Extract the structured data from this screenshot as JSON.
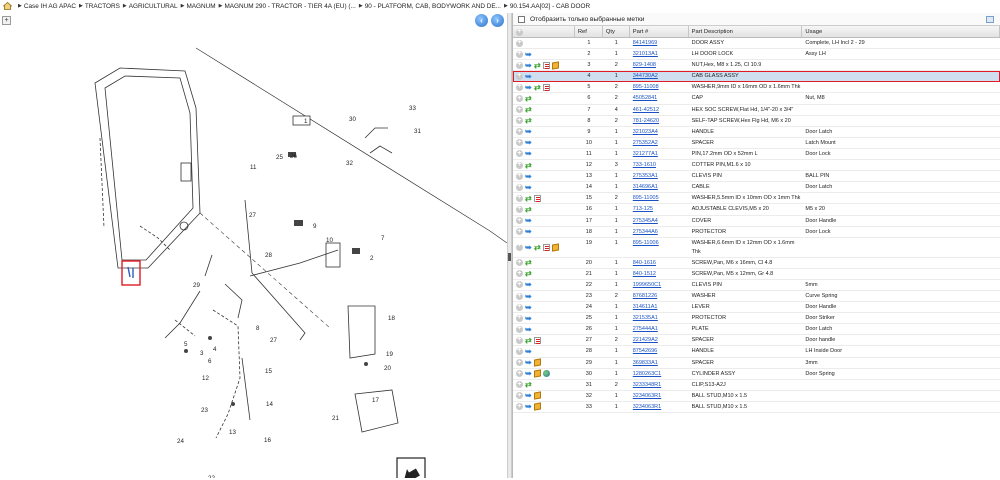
{
  "breadcrumb": [
    "Case IH AG APAC",
    "TRACTORS",
    "AGRICULTURAL",
    "MAGNUM",
    "MAGNUM 290 - TRACTOR - TIER 4A (EU) (...",
    "90 - PLATFORM, CAB, BODYWORK AND DE...",
    "90.154.AA[02] - CAB DOOR"
  ],
  "left_toolbar": {
    "expand_symbol": "+",
    "prev_symbol": "‹",
    "next_symbol": "›"
  },
  "diagram": {
    "callouts": [
      "1",
      "2",
      "3",
      "4",
      "5",
      "6",
      "7",
      "8",
      "9",
      "10",
      "11",
      "12",
      "13",
      "14",
      "15",
      "16",
      "17",
      "18",
      "19",
      "20",
      "21",
      "22",
      "23",
      "24",
      "25",
      "26",
      "27",
      "27",
      "28",
      "29",
      "30",
      "31",
      "32",
      "33"
    ]
  },
  "filter": {
    "label": "Отобразить только выбранные метки",
    "checked": false
  },
  "table": {
    "columns": [
      "Ref",
      "Qty",
      "Part #",
      "Part Description",
      "Usage"
    ],
    "rows": [
      {
        "icons": [
          "plus"
        ],
        "ref": "1",
        "qty": "1",
        "part": "84141969",
        "desc": "DOOR ASSY",
        "usage": "Complete, LH Incl 2 - 29"
      },
      {
        "icons": [
          "plus",
          "info"
        ],
        "ref": "2",
        "qty": "1",
        "part": "321013A1",
        "desc": "LH DOOR LOCK",
        "usage": "Assy LH"
      },
      {
        "icons": [
          "plus",
          "info",
          "swap",
          "doc",
          "box"
        ],
        "ref": "3",
        "qty": "2",
        "part": "829-1408",
        "desc": "NUT,Hex, M8 x 1.25, Cl 10.9",
        "usage": ""
      },
      {
        "icons": [
          "plus",
          "info"
        ],
        "ref": "4",
        "qty": "1",
        "part": "344730A2",
        "desc": "CAB GLASS ASSY",
        "usage": "",
        "selected": true
      },
      {
        "icons": [
          "plus",
          "info",
          "swap",
          "doc"
        ],
        "ref": "5",
        "qty": "2",
        "part": "895-11008",
        "desc": "WASHER,9mm ID x 16mm OD x 1.6mm Thk",
        "usage": ""
      },
      {
        "icons": [
          "plus",
          "swap"
        ],
        "ref": "6",
        "qty": "2",
        "part": "45052841",
        "desc": "CAP",
        "usage": "Nut, M8"
      },
      {
        "icons": [
          "plus",
          "swap"
        ],
        "ref": "7",
        "qty": "4",
        "part": "461-42512",
        "desc": "HEX SOC SCREW,Flat Hd, 1/4\"-20 x 3/4\"",
        "usage": ""
      },
      {
        "icons": [
          "plus",
          "swap"
        ],
        "ref": "8",
        "qty": "2",
        "part": "781-24620",
        "desc": "SELF-TAP SCREW,Hex Flg Hd, M6 x 20",
        "usage": ""
      },
      {
        "icons": [
          "plus",
          "info"
        ],
        "ref": "9",
        "qty": "1",
        "part": "321023A4",
        "desc": "HANDLE",
        "usage": "Door Latch"
      },
      {
        "icons": [
          "plus",
          "info"
        ],
        "ref": "10",
        "qty": "1",
        "part": "275352A2",
        "desc": "SPACER",
        "usage": "Latch Mount"
      },
      {
        "icons": [
          "plus",
          "info"
        ],
        "ref": "11",
        "qty": "1",
        "part": "321277A1",
        "desc": "PIN,17.2mm OD x 52mm L",
        "usage": "Door Lock"
      },
      {
        "icons": [
          "plus",
          "swap"
        ],
        "ref": "12",
        "qty": "3",
        "part": "733-1610",
        "desc": "COTTER PIN,M1.6 x 10",
        "usage": ""
      },
      {
        "icons": [
          "plus",
          "info"
        ],
        "ref": "13",
        "qty": "1",
        "part": "275353A1",
        "desc": "CLEVIS PIN",
        "usage": "BALL PIN"
      },
      {
        "icons": [
          "plus",
          "info"
        ],
        "ref": "14",
        "qty": "1",
        "part": "314696A1",
        "desc": "CABLE",
        "usage": "Door Latch"
      },
      {
        "icons": [
          "plus",
          "swap",
          "doc"
        ],
        "ref": "15",
        "qty": "2",
        "part": "895-11005",
        "desc": "WASHER,5.5mm ID x 10mm OD x 1mm Thk",
        "usage": ""
      },
      {
        "icons": [
          "plus",
          "swap"
        ],
        "ref": "16",
        "qty": "1",
        "part": "713-125",
        "desc": "ADJUSTABLE CLEVIS,M5 x 20",
        "usage": "M5 x 20"
      },
      {
        "icons": [
          "plus",
          "info"
        ],
        "ref": "17",
        "qty": "1",
        "part": "275345A4",
        "desc": "COVER",
        "usage": "Door Handle"
      },
      {
        "icons": [
          "plus",
          "info"
        ],
        "ref": "18",
        "qty": "1",
        "part": "275344A6",
        "desc": "PROTECTOR",
        "usage": "Door Lock"
      },
      {
        "icons": [
          "plus",
          "info",
          "swap",
          "doc",
          "box"
        ],
        "ref": "19",
        "qty": "1",
        "part": "895-11006",
        "desc": "WASHER,6.6mm ID x 12mm OD x 1.6mm Thk",
        "usage": "",
        "tall": true
      },
      {
        "icons": [
          "plus",
          "swap"
        ],
        "ref": "20",
        "qty": "1",
        "part": "840-1616",
        "desc": "SCREW,Pan, M6 x 16mm, Cl 4.8",
        "usage": ""
      },
      {
        "icons": [
          "plus",
          "swap"
        ],
        "ref": "21",
        "qty": "1",
        "part": "840-1512",
        "desc": "SCREW,Pan, M5 x 12mm, Gr 4.8",
        "usage": ""
      },
      {
        "icons": [
          "plus",
          "info"
        ],
        "ref": "22",
        "qty": "1",
        "part": "1999650C1",
        "desc": "CLEVIS PIN",
        "usage": "5mm"
      },
      {
        "icons": [
          "plus",
          "info"
        ],
        "ref": "23",
        "qty": "2",
        "part": "87681226",
        "desc": "WASHER",
        "usage": "Curve Spring"
      },
      {
        "icons": [
          "plus",
          "info"
        ],
        "ref": "24",
        "qty": "1",
        "part": "314611A1",
        "desc": "LEVER",
        "usage": "Door Handle"
      },
      {
        "icons": [
          "plus",
          "info"
        ],
        "ref": "25",
        "qty": "1",
        "part": "321535A1",
        "desc": "PROTECTOR",
        "usage": "Door Striker"
      },
      {
        "icons": [
          "plus",
          "info"
        ],
        "ref": "26",
        "qty": "1",
        "part": "275444A1",
        "desc": "PLATE",
        "usage": "Door Latch"
      },
      {
        "icons": [
          "plus",
          "swap",
          "doc"
        ],
        "ref": "27",
        "qty": "2",
        "part": "221429A2",
        "desc": "SPACER",
        "usage": "Door handle"
      },
      {
        "icons": [
          "plus",
          "info"
        ],
        "ref": "28",
        "qty": "1",
        "part": "87542696",
        "desc": "HANDLE",
        "usage": "LH Inside Door"
      },
      {
        "icons": [
          "plus",
          "info",
          "box"
        ],
        "ref": "29",
        "qty": "1",
        "part": "369833A1",
        "desc": "SPACER",
        "usage": "3mm"
      },
      {
        "icons": [
          "plus",
          "info",
          "box",
          "globe"
        ],
        "ref": "30",
        "qty": "1",
        "part": "1280263C1",
        "desc": "CYLINDER ASSY",
        "usage": "Door Spring"
      },
      {
        "icons": [
          "plus",
          "swap"
        ],
        "ref": "31",
        "qty": "2",
        "part": "3233348R1",
        "desc": "CLIP,S13-A2J",
        "usage": ""
      },
      {
        "icons": [
          "plus",
          "info",
          "box"
        ],
        "ref": "32",
        "qty": "1",
        "part": "3234063R1",
        "desc": "BALL STUD,M10 x 1.5",
        "usage": ""
      },
      {
        "icons": [
          "plus",
          "info",
          "box"
        ],
        "ref": "33",
        "qty": "1",
        "part": "3234063R1",
        "desc": "BALL STUD,M10 x 1.5",
        "usage": ""
      }
    ]
  },
  "colors": {
    "link": "#1a52c6",
    "selected_row": "#cfdff0",
    "highlight": "#e01b24"
  }
}
